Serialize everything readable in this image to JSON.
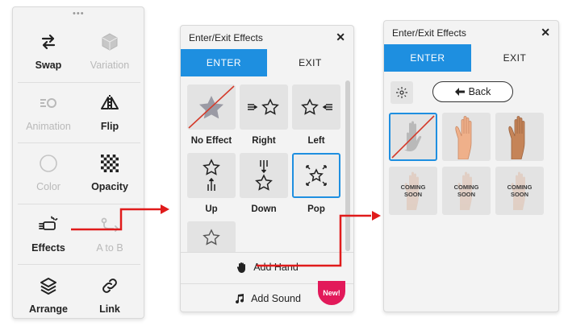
{
  "toolbar": {
    "handle": "•••",
    "rows": [
      [
        {
          "label": "Swap",
          "icon": "swap-arrows-icon",
          "enabled": true
        },
        {
          "label": "Variation",
          "icon": "cube-icon",
          "enabled": false
        }
      ],
      [
        {
          "label": "Animation",
          "icon": "animation-icon",
          "enabled": false
        },
        {
          "label": "Flip",
          "icon": "flip-icon",
          "enabled": true
        }
      ],
      [
        {
          "label": "Color",
          "icon": "circle-icon",
          "enabled": false
        },
        {
          "label": "Opacity",
          "icon": "checker-icon",
          "enabled": true
        }
      ],
      [
        {
          "label": "Effects",
          "icon": "sparkle-arrow-icon",
          "enabled": true
        },
        {
          "label": "A to B",
          "icon": "path-icon",
          "enabled": false
        }
      ],
      [
        {
          "label": "Arrange",
          "icon": "layers-icon",
          "enabled": true
        },
        {
          "label": "Link",
          "icon": "chain-link-icon",
          "enabled": true
        }
      ]
    ]
  },
  "effects_a": {
    "title": "Enter/Exit Effects",
    "close": "✕",
    "tabs": [
      "ENTER",
      "EXIT"
    ],
    "effects": [
      {
        "label": "No Effect",
        "icon": "no-effect-star-icon"
      },
      {
        "label": "Right",
        "icon": "star-from-left-icon"
      },
      {
        "label": "Left",
        "icon": "star-from-right-icon"
      },
      {
        "label": "Up",
        "icon": "star-up-icon"
      },
      {
        "label": "Down",
        "icon": "star-down-icon"
      },
      {
        "label": "Pop",
        "icon": "star-pop-icon"
      }
    ],
    "add_hand": "Add Hand",
    "add_sound": "Add Sound",
    "new_badge": "New!"
  },
  "effects_b": {
    "title": "Enter/Exit Effects",
    "close": "✕",
    "tabs": [
      "ENTER",
      "EXIT"
    ],
    "back": "Back",
    "coming_soon": "COMING\nSOON",
    "coming_line1": "COMING",
    "coming_line2": "SOON"
  },
  "colors": {
    "accent": "#1e8fe0",
    "arrow": "#e01b1b",
    "badge": "#e2195a"
  }
}
